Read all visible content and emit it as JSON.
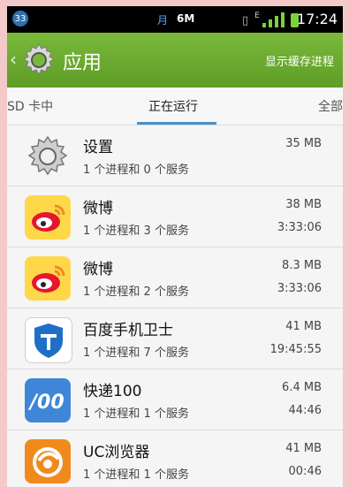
{
  "status_bar": {
    "badge": "33",
    "moon": "月",
    "data_indicator": "6M",
    "network_e": "E",
    "time": "17:24"
  },
  "action_bar": {
    "title": "应用",
    "show_cached_label": "显示缓存进程"
  },
  "tabs": [
    {
      "label": "SD 卡中",
      "selected": false
    },
    {
      "label": "正在运行",
      "selected": true
    },
    {
      "label": "全部",
      "selected": false
    }
  ],
  "processes": [
    {
      "name": "设置",
      "desc": "1 个进程和 0 个服务",
      "size": "35 MB",
      "time": "",
      "icon": "settings-gear-icon"
    },
    {
      "name": "微博",
      "desc": "1 个进程和 3 个服务",
      "size": "38 MB",
      "time": "3:33:06",
      "icon": "weibo-icon"
    },
    {
      "name": "微博",
      "desc": "1 个进程和 2 个服务",
      "size": "8.3 MB",
      "time": "3:33:06",
      "icon": "weibo-icon"
    },
    {
      "name": "百度手机卫士",
      "desc": "1 个进程和 7 个服务",
      "size": "41 MB",
      "time": "19:45:55",
      "icon": "baidu-guard-icon"
    },
    {
      "name": "快递100",
      "desc": "1 个进程和 1 个服务",
      "size": "6.4 MB",
      "time": "44:46",
      "icon": "kuaidi100-icon"
    },
    {
      "name": "UC浏览器",
      "desc": "1 个进程和 1 个服务",
      "size": "41 MB",
      "time": "00:46",
      "icon": "uc-browser-icon"
    }
  ]
}
